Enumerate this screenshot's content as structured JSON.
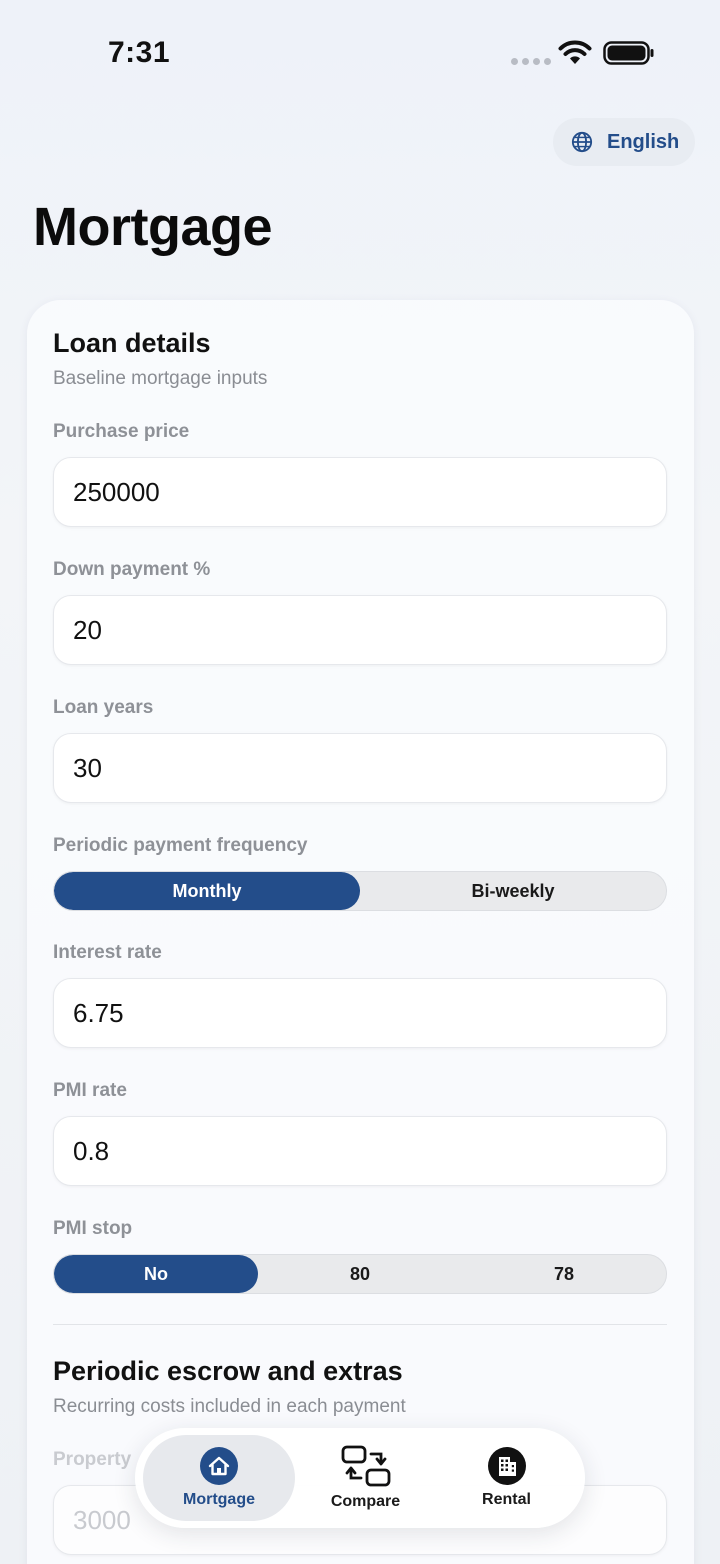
{
  "status": {
    "time": "7:31"
  },
  "language": {
    "label": "English"
  },
  "page": {
    "title": "Mortgage"
  },
  "loan": {
    "title": "Loan details",
    "subtitle": "Baseline mortgage inputs",
    "purchase_price": {
      "label": "Purchase price",
      "value": "250000"
    },
    "down_payment": {
      "label": "Down payment %",
      "value": "20"
    },
    "loan_years": {
      "label": "Loan years",
      "value": "30"
    },
    "frequency": {
      "label": "Periodic payment frequency",
      "options": [
        "Monthly",
        "Bi-weekly"
      ],
      "selected": "Monthly"
    },
    "interest_rate": {
      "label": "Interest rate",
      "value": "6.75"
    },
    "pmi_rate": {
      "label": "PMI rate",
      "value": "0.8"
    },
    "pmi_stop": {
      "label": "PMI stop",
      "options": [
        "No",
        "80",
        "78"
      ],
      "selected": "No"
    }
  },
  "escrow": {
    "title": "Periodic escrow and extras",
    "subtitle": "Recurring costs included in each payment",
    "property": {
      "label": "Property",
      "value": "3000"
    }
  },
  "tabs": [
    {
      "label": "Mortgage",
      "icon": "house-icon",
      "active": true
    },
    {
      "label": "Compare",
      "icon": "compare-icon",
      "active": false
    },
    {
      "label": "Rental",
      "icon": "building-icon",
      "active": false
    }
  ],
  "colors": {
    "accent": "#234d8a",
    "background": "#eef2f9"
  }
}
